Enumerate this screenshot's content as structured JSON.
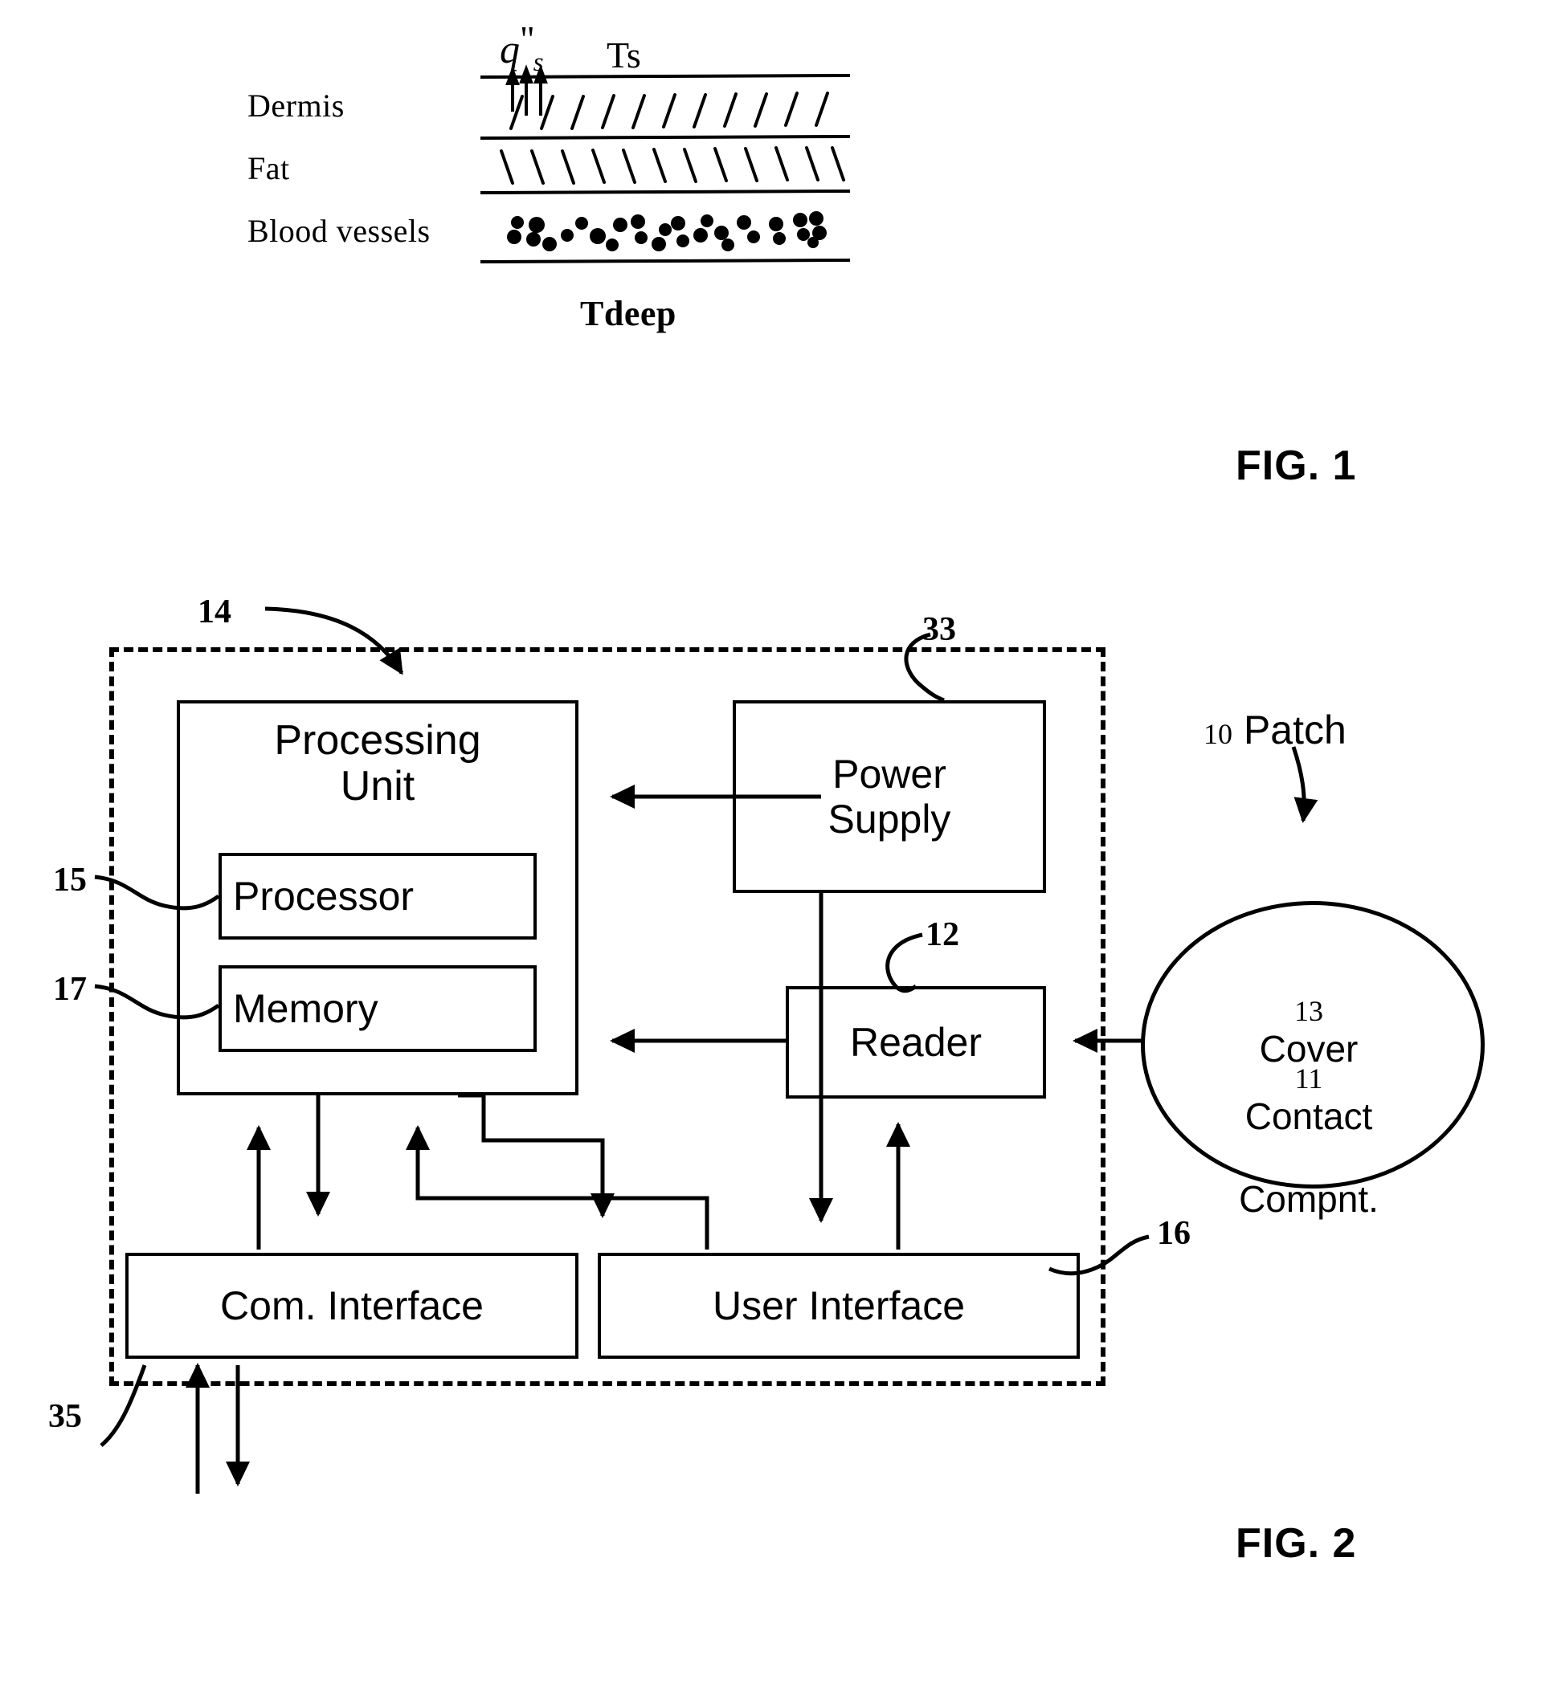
{
  "figure1": {
    "caption": "FIG. 1",
    "layer_labels": [
      "Dermis",
      "Fat",
      "Blood vessels"
    ],
    "symbols": {
      "heat_flux": "q\"s",
      "heat_flux_base": "q",
      "heat_flux_primes": "\"",
      "heat_flux_sub": "s",
      "surface_temp": "Ts",
      "deep_temp": "Tdeep"
    }
  },
  "figure2": {
    "caption": "FIG. 2",
    "blocks": [
      {
        "id": "processing_unit",
        "label": "Processing\nUnit",
        "ref": "14"
      },
      {
        "id": "processor",
        "label": "Processor",
        "ref": "15"
      },
      {
        "id": "memory",
        "label": "Memory",
        "ref": "17"
      },
      {
        "id": "power_supply",
        "label": "Power\nSupply",
        "ref": "33"
      },
      {
        "id": "reader",
        "label": "Reader",
        "ref": "12"
      },
      {
        "id": "com_interface",
        "label": "Com. Interface",
        "ref": "35"
      },
      {
        "id": "user_interface",
        "label": "User Interface",
        "ref": "16"
      }
    ],
    "patch": {
      "title_ref": "10",
      "title_label": "Patch",
      "cover_ref": "13",
      "cover_label": "Cover",
      "contact_ref": "11",
      "contact_label": "Contact\nCompnt."
    },
    "reference_numerals": {
      "processing_unit": "14",
      "processor": "15",
      "memory": "17",
      "power_supply": "33",
      "reader": "12",
      "user_interface": "16",
      "com_interface": "35",
      "patch": "10",
      "cover": "13",
      "contact_component": "11"
    }
  },
  "colors": {
    "ink": "#000000",
    "paper": "#ffffff"
  }
}
